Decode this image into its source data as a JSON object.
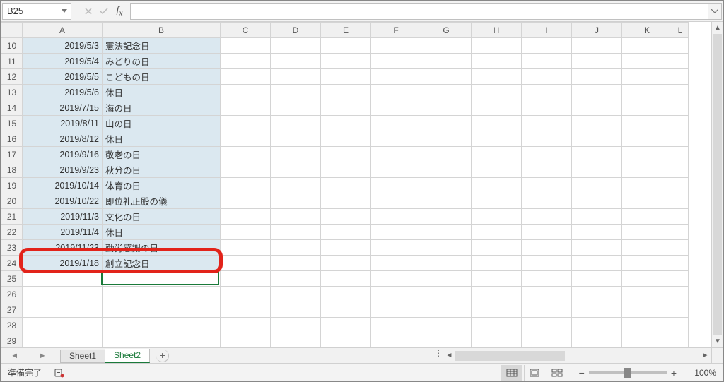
{
  "name_box": "B25",
  "formula_value": "",
  "columns": [
    "A",
    "B",
    "C",
    "D",
    "E",
    "F",
    "G",
    "H",
    "I",
    "J",
    "K",
    "L"
  ],
  "row_start": 10,
  "row_end": 29,
  "rows": [
    {
      "n": 10,
      "date": "2019/5/3",
      "name": "憲法記念日"
    },
    {
      "n": 11,
      "date": "2019/5/4",
      "name": "みどりの日"
    },
    {
      "n": 12,
      "date": "2019/5/5",
      "name": "こどもの日"
    },
    {
      "n": 13,
      "date": "2019/5/6",
      "name": "休日"
    },
    {
      "n": 14,
      "date": "2019/7/15",
      "name": "海の日"
    },
    {
      "n": 15,
      "date": "2019/8/11",
      "name": "山の日"
    },
    {
      "n": 16,
      "date": "2019/8/12",
      "name": "休日"
    },
    {
      "n": 17,
      "date": "2019/9/16",
      "name": "敬老の日"
    },
    {
      "n": 18,
      "date": "2019/9/23",
      "name": "秋分の日"
    },
    {
      "n": 19,
      "date": "2019/10/14",
      "name": "体育の日"
    },
    {
      "n": 20,
      "date": "2019/10/22",
      "name": "即位礼正殿の儀"
    },
    {
      "n": 21,
      "date": "2019/11/3",
      "name": "文化の日"
    },
    {
      "n": 22,
      "date": "2019/11/4",
      "name": "休日"
    },
    {
      "n": 23,
      "date": "2019/11/23",
      "name": "勤労感謝の日"
    },
    {
      "n": 24,
      "date": "2019/1/18",
      "name": "創立記念日"
    },
    {
      "n": 25,
      "date": "",
      "name": ""
    },
    {
      "n": 26,
      "date": "",
      "name": ""
    },
    {
      "n": 27,
      "date": "",
      "name": ""
    },
    {
      "n": 28,
      "date": "",
      "name": ""
    },
    {
      "n": 29,
      "date": "",
      "name": ""
    }
  ],
  "filled_rows": [
    10,
    11,
    12,
    13,
    14,
    15,
    16,
    17,
    18,
    19,
    20,
    21,
    22,
    23,
    24
  ],
  "active_cell": "B25",
  "highlight_row": 24,
  "sheets": [
    {
      "name": "Sheet1",
      "active": false
    },
    {
      "name": "Sheet2",
      "active": true
    }
  ],
  "status": {
    "ready": "準備完了",
    "zoom": "100%"
  },
  "colors": {
    "cell_fill": "#dbe8f0",
    "active_border": "#1a7a3a",
    "highlight_border": "#e2231a"
  }
}
